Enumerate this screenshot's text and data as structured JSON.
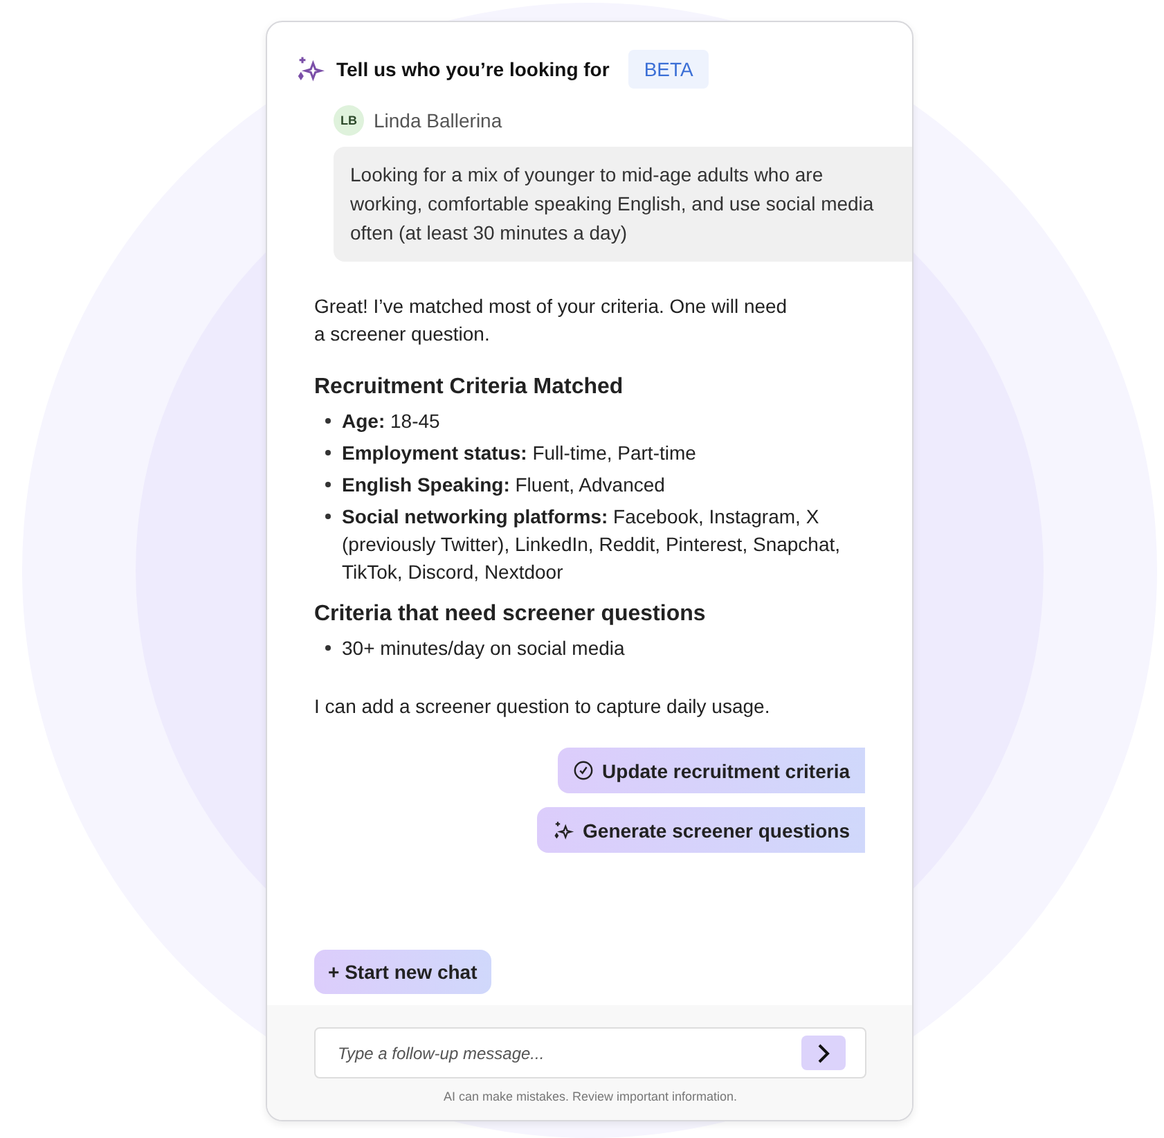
{
  "header": {
    "title": "Tell us who you’re looking for",
    "badge": "BETA"
  },
  "user_message": {
    "initials": "LB",
    "name": "Linda Ballerina",
    "text": "Looking for a mix of younger to mid-age adults who are working, comfortable speaking English, and use social media often (at least 30 minutes a day)"
  },
  "reply": {
    "intro": "Great! I’ve matched most of your criteria. One will need a screener question.",
    "sections": [
      {
        "heading": "Recruitment Criteria Matched",
        "items": [
          "**Age:** 18-45",
          "**Employment status:** Full-time, Part-time",
          "**English Speaking:** Fluent, Advanced",
          "**Social networking platforms:** Facebook, Instagram, X (previously Twitter), LinkedIn, Reddit, Pinterest, Snapchat, TikTok, Discord, Nextdoor"
        ]
      },
      {
        "heading": "Criteria that need screener questions",
        "items": [
          "30+ minutes/day on social media"
        ]
      }
    ],
    "outro": "I can add a screener question to capture daily usage."
  },
  "actions": [
    {
      "kind": "check",
      "label": "Update recruitment criteria"
    },
    {
      "kind": "sparkle",
      "label": "Generate screener questions"
    }
  ],
  "new_chat": "+ Start new chat",
  "composer": {
    "placeholder": "Type a follow-up message...",
    "disclaimer": "AI can make mistakes. Review important information."
  }
}
